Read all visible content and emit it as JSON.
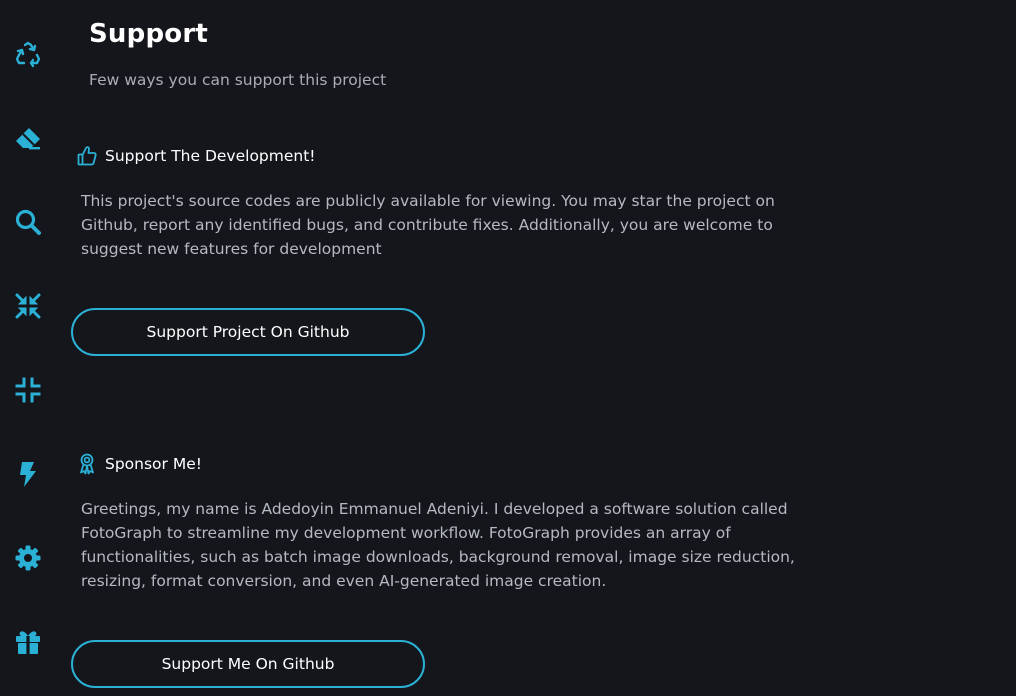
{
  "sidebar": {
    "items": [
      {
        "name": "recycle",
        "icon": "recycle-icon"
      },
      {
        "name": "eraser",
        "icon": "eraser-icon"
      },
      {
        "name": "search",
        "icon": "search-icon"
      },
      {
        "name": "compress",
        "icon": "compress-arrows-icon"
      },
      {
        "name": "minimize",
        "icon": "compress-icon"
      },
      {
        "name": "bolt",
        "icon": "bolt-icon"
      },
      {
        "name": "settings",
        "icon": "gear-icon"
      },
      {
        "name": "support",
        "icon": "gift-icon",
        "active": true
      }
    ],
    "icon_color": "#2bb0d6"
  },
  "page": {
    "title": "Support",
    "subtitle": "Few ways you can support this project"
  },
  "sections": [
    {
      "icon": "thumbs-up-icon",
      "heading": "Support The Development!",
      "body": "This project's source codes are publicly available for viewing. You may star the project on Github, report any identified bugs, and contribute fixes. Additionally, you are welcome to suggest new features for development",
      "button_label": "Support Project On Github"
    },
    {
      "icon": "award-ribbon-icon",
      "heading": "Sponsor Me!",
      "body": "Greetings, my name is Adedoyin Emmanuel Adeniyi. I developed a software solution called FotoGraph to streamline my development workflow. FotoGraph provides an array of functionalities, such as batch image downloads, background removal, image size reduction, resizing, format conversion, and even AI-generated image creation.",
      "button_label": "Support Me On Github"
    }
  ],
  "colors": {
    "background": "#14161c",
    "accent": "#2bb0d6",
    "text": "#ffffff",
    "muted_text": "#b5b9c1"
  }
}
